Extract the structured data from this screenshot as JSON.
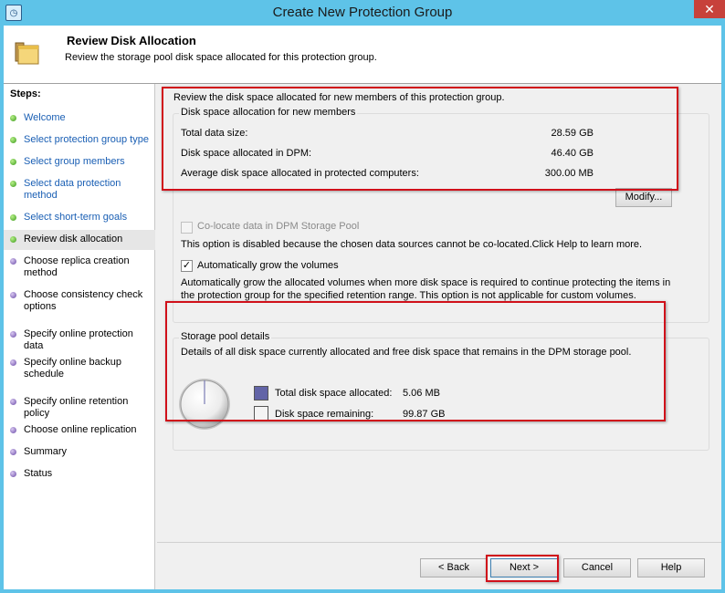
{
  "window": {
    "title": "Create New Protection Group",
    "close_glyph": "✕",
    "app_icon": "dpm-app-icon",
    "accent_color": "#5ec3e8"
  },
  "header": {
    "title": "Review Disk Allocation",
    "subtitle": "Review the storage pool disk space allocated for this protection group.",
    "icon": "folder-stack-icon"
  },
  "steps": {
    "title": "Steps:",
    "items": [
      {
        "label": "Welcome",
        "state": "done"
      },
      {
        "label": "Select protection group type",
        "state": "done"
      },
      {
        "label": "Select group members",
        "state": "done"
      },
      {
        "label": "Select data protection method",
        "state": "done"
      },
      {
        "label": "Select short-term goals",
        "state": "done"
      },
      {
        "label": "Review disk allocation",
        "state": "current"
      },
      {
        "label": "Choose replica creation method",
        "state": "todo"
      },
      {
        "label": "Choose consistency check options",
        "state": "todo"
      },
      {
        "label": "Specify online protection data",
        "state": "todo"
      },
      {
        "label": "Specify online backup schedule",
        "state": "todo"
      },
      {
        "label": "Specify online retention policy",
        "state": "todo"
      },
      {
        "label": "Choose online replication",
        "state": "todo"
      },
      {
        "label": "Summary",
        "state": "todo"
      },
      {
        "label": "Status",
        "state": "todo"
      }
    ]
  },
  "main": {
    "intro": "Review the disk space allocated for new members of this protection group.",
    "allocation": {
      "group_label": "Disk space allocation for new members",
      "rows": [
        {
          "label": "Total data size:",
          "value": "28.59 GB"
        },
        {
          "label": "Disk space allocated in DPM:",
          "value": "46.40 GB"
        },
        {
          "label": "Average disk space allocated in protected computers:",
          "value": "300.00 MB"
        }
      ],
      "modify_button": "Modify..."
    },
    "colocate": {
      "label": "Co-locate data in DPM Storage Pool",
      "checked": false,
      "disabled": true,
      "note": "This option is disabled because the chosen data sources cannot be co-located.Click Help to learn more."
    },
    "autogrow": {
      "label": "Automatically grow the volumes",
      "checked": true,
      "check_glyph": "✓",
      "note": "Automatically grow the allocated volumes when more disk space is required to continue protecting the items in the protection group for the specified retention range. This option is not applicable for custom volumes."
    },
    "storage_pool": {
      "group_label": "Storage pool details",
      "description": "Details of all disk space currently allocated and free disk space that remains in the DPM storage pool.",
      "allocated_fraction": 5e-05,
      "legend": [
        {
          "label": "Total disk space allocated:",
          "value": "5.06 MB",
          "color": "#6264a7"
        },
        {
          "label": "Disk space remaining:",
          "value": "99.87 GB",
          "color": "#f4f4f4"
        }
      ]
    }
  },
  "footer": {
    "back": "< Back",
    "next": "Next >",
    "cancel": "Cancel",
    "help": "Help"
  }
}
